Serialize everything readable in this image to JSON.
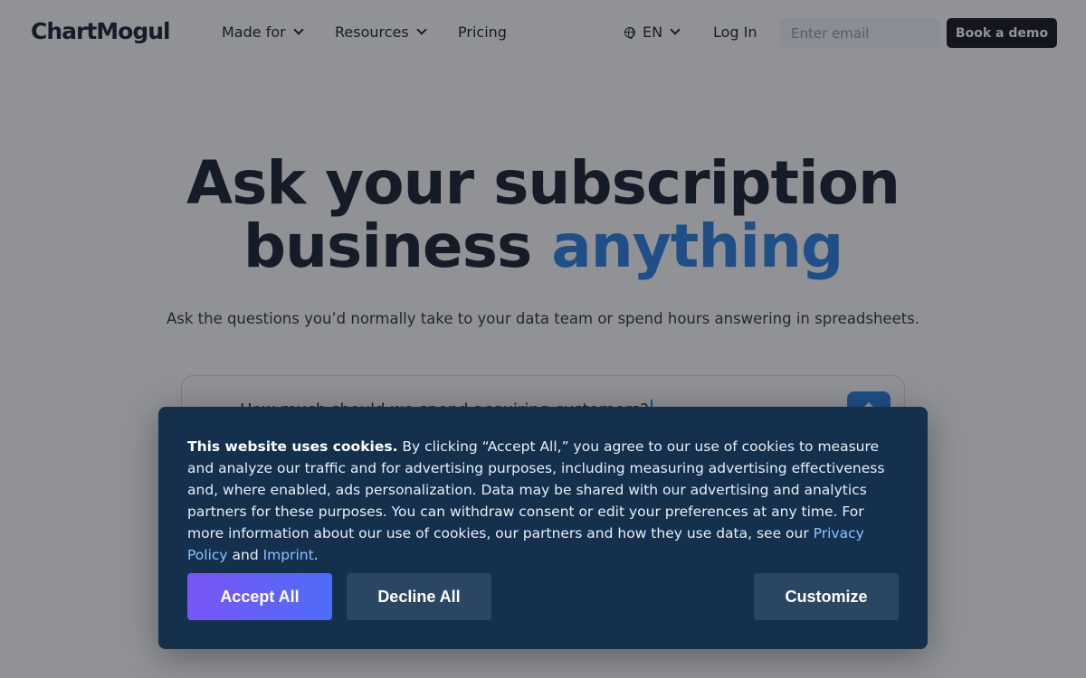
{
  "nav": {
    "logo": "ChartMogul",
    "made_for": "Made for",
    "resources": "Resources",
    "pricing": "Pricing",
    "language": "EN",
    "login": "Log In",
    "email_placeholder": "Enter email",
    "book_demo": "Book a demo"
  },
  "hero": {
    "title_line1": "Ask your subscription",
    "title_line2_part1": "business ",
    "title_line2_accent": "anything",
    "subtitle": "Ask the questions you’d normally take to your data team or spend hours answering in spreadsheets.",
    "ask_text": "How much should we spend acquiring customers?",
    "send_icon": "arrow-up-icon"
  },
  "cookie": {
    "heading": "This website uses cookies.",
    "body_before_links": " By clicking “Accept All,” you agree to our use of cookies to measure and analyze our traffic and for advertising purposes, including measuring advertising effectiveness and, where enabled, ads personalization. Data may be shared with our advertising and analytics partners for these purposes. You can withdraw consent or edit your preferences at any time. For more information about our use of cookies, our partners and how they use data, see our ",
    "privacy_link": "Privacy Policy",
    "and": " and ",
    "imprint_link": "Imprint",
    "period": ".",
    "accept": "Accept All",
    "decline": "Decline All",
    "customize": "Customize"
  },
  "colors": {
    "accent": "#1f78e0",
    "dialog_bg": "#14304d",
    "secondary_btn": "#2a4662",
    "accept_gradient_start": "#7a55f5",
    "accept_gradient_end": "#4f6cf7"
  }
}
